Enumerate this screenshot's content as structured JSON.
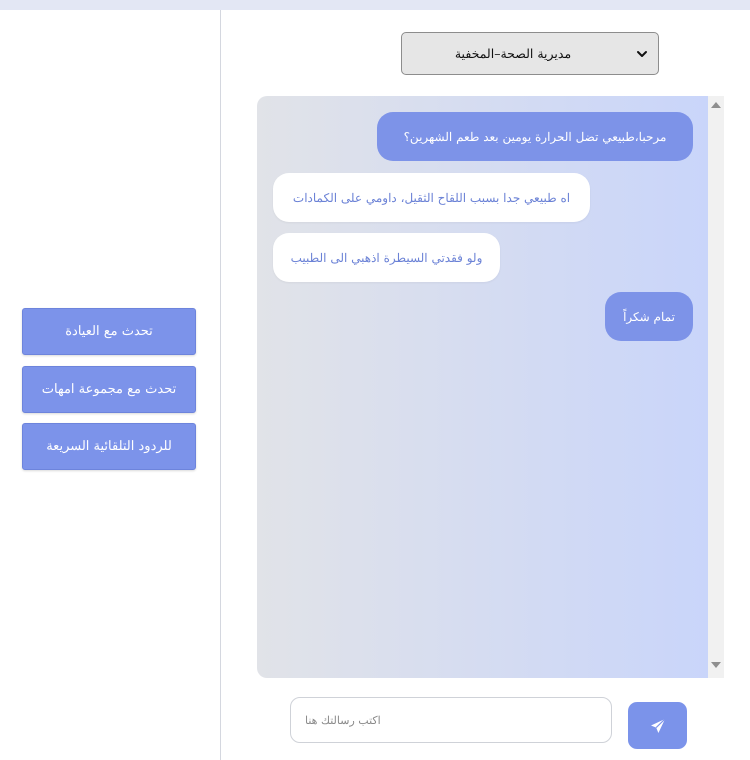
{
  "sidebar": {
    "buttons": [
      {
        "label": "تحدث مع العيادة"
      },
      {
        "label": "تحدث مع مجموعة امهات"
      },
      {
        "label": "للردود التلقائية السريعة"
      }
    ]
  },
  "channel_select": {
    "selected": "مديرية الصحة–المخفية"
  },
  "chat": {
    "messages": [
      {
        "sender": "user",
        "text": "مرحبا،طبيعي تضل الحرارة يومين بعد طعم الشهرين؟"
      },
      {
        "sender": "other",
        "text": "اه طبيعي جدا بسبب اللقاح الثقيل، داومي على الكمادات"
      },
      {
        "sender": "other",
        "text": "ولو فقدتي السيطرة اذهبي الى الطبيب"
      },
      {
        "sender": "user",
        "text": "تمام شكراً"
      }
    ]
  },
  "composer": {
    "placeholder": "اكتب رسالتك هنا"
  },
  "icons": {
    "send": "paper-plane-icon",
    "dropdown": "chevron-down-icon"
  },
  "colors": {
    "accent": "#7c93ea",
    "sent_bubble": "#7d93e8",
    "received_text": "#6b82d6"
  }
}
